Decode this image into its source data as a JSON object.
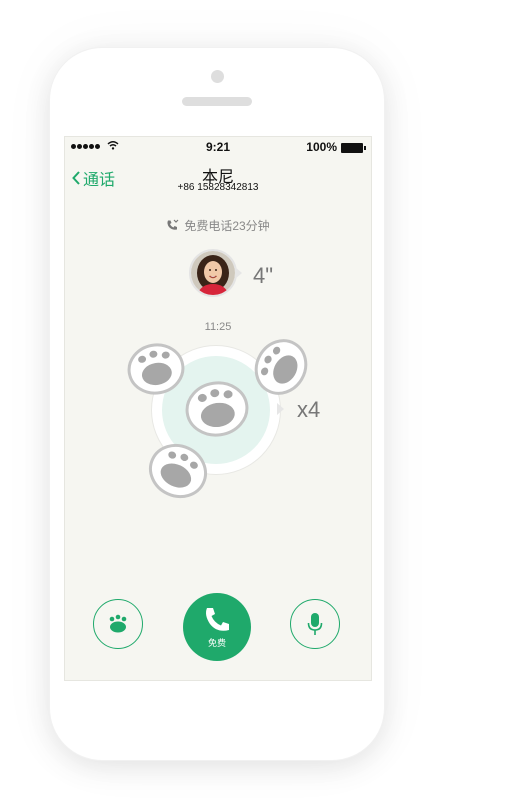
{
  "status_bar": {
    "time": "9:21",
    "battery": "100%"
  },
  "nav": {
    "back_label": "通话"
  },
  "contact": {
    "name": "本尼",
    "phone": "+86 15828342813"
  },
  "call_info": {
    "free_minutes": "免费电话23分钟",
    "voice_duration": "4\"",
    "timestamp": "11:25",
    "paw_count": "x4"
  },
  "actions": {
    "call_label": "免费"
  },
  "icons": {
    "back": "chevron-left-icon",
    "free_call": "phone-call-icon",
    "paw": "paw-icon",
    "call": "phone-icon",
    "mic": "microphone-icon",
    "wifi": "wifi-icon",
    "battery": "battery-icon"
  },
  "colors": {
    "accent": "#1fa96b",
    "background": "#f6f6f1",
    "paw_bubble": "#e4f4ef"
  }
}
